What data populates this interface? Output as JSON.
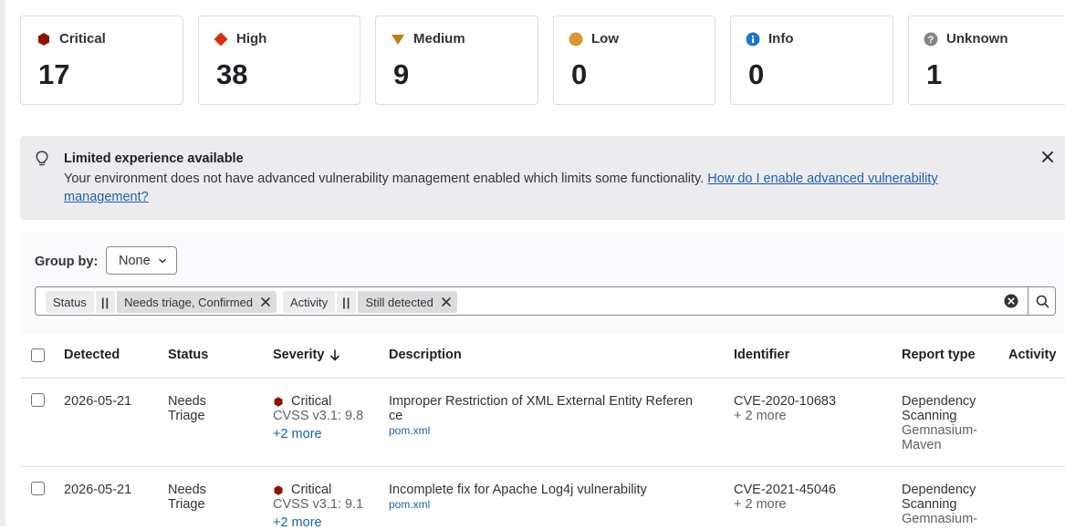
{
  "severity_cards": [
    {
      "label": "Critical",
      "count": "17",
      "icon": "critical-icon",
      "color": "#8d1300"
    },
    {
      "label": "High",
      "count": "38",
      "icon": "high-icon",
      "color": "#dd2b0e"
    },
    {
      "label": "Medium",
      "count": "9",
      "icon": "medium-icon",
      "color": "#c17d10"
    },
    {
      "label": "Low",
      "count": "0",
      "icon": "low-icon",
      "color": "#d99530"
    },
    {
      "label": "Info",
      "count": "0",
      "icon": "info-icon",
      "color": "#1f75cb"
    },
    {
      "label": "Unknown",
      "count": "1",
      "icon": "unknown-icon",
      "color": "#868686"
    }
  ],
  "alert": {
    "title": "Limited experience available",
    "body": "Your environment does not have advanced vulnerability management enabled which limits some functionality. ",
    "link_text": "How do I enable advanced vulnerability management?"
  },
  "group_by": {
    "label": "Group by:",
    "value": "None"
  },
  "filters": [
    {
      "name": "Status",
      "operator": "||",
      "value": "Needs triage, Confirmed"
    },
    {
      "name": "Activity",
      "operator": "||",
      "value": "Still detected"
    }
  ],
  "table": {
    "columns": [
      "Detected",
      "Status",
      "Severity",
      "Description",
      "Identifier",
      "Report type",
      "Activity"
    ],
    "rows": [
      {
        "detected": "2026-05-21",
        "status_line1": "Needs",
        "status_line2": "Triage",
        "severity": "Critical",
        "cvss": "CVSS v3.1: 9.8",
        "more": "+2 more",
        "description_line1": "Improper Restriction of XML External Entity Referen",
        "description_line2": "ce",
        "file": "pom.xml",
        "identifier": "CVE-2020-10683",
        "identifier_more": "+ 2 more",
        "report_type_line1": "Dependency",
        "report_type_line2": "Scanning",
        "scanner_line1": "Gemnasium-",
        "scanner_line2": "Maven"
      },
      {
        "detected": "2026-05-21",
        "status_line1": "Needs",
        "status_line2": "Triage",
        "severity": "Critical",
        "cvss": "CVSS v3.1: 9.1",
        "more": "+2 more",
        "description_line1": "Incomplete fix for Apache Log4j vulnerability",
        "file": "pom.xml",
        "identifier": "CVE-2021-45046",
        "identifier_more": "+ 2 more",
        "report_type_line1": "Dependency",
        "report_type_line2": "Scanning",
        "scanner_line1": "Gemnasium-"
      }
    ]
  }
}
